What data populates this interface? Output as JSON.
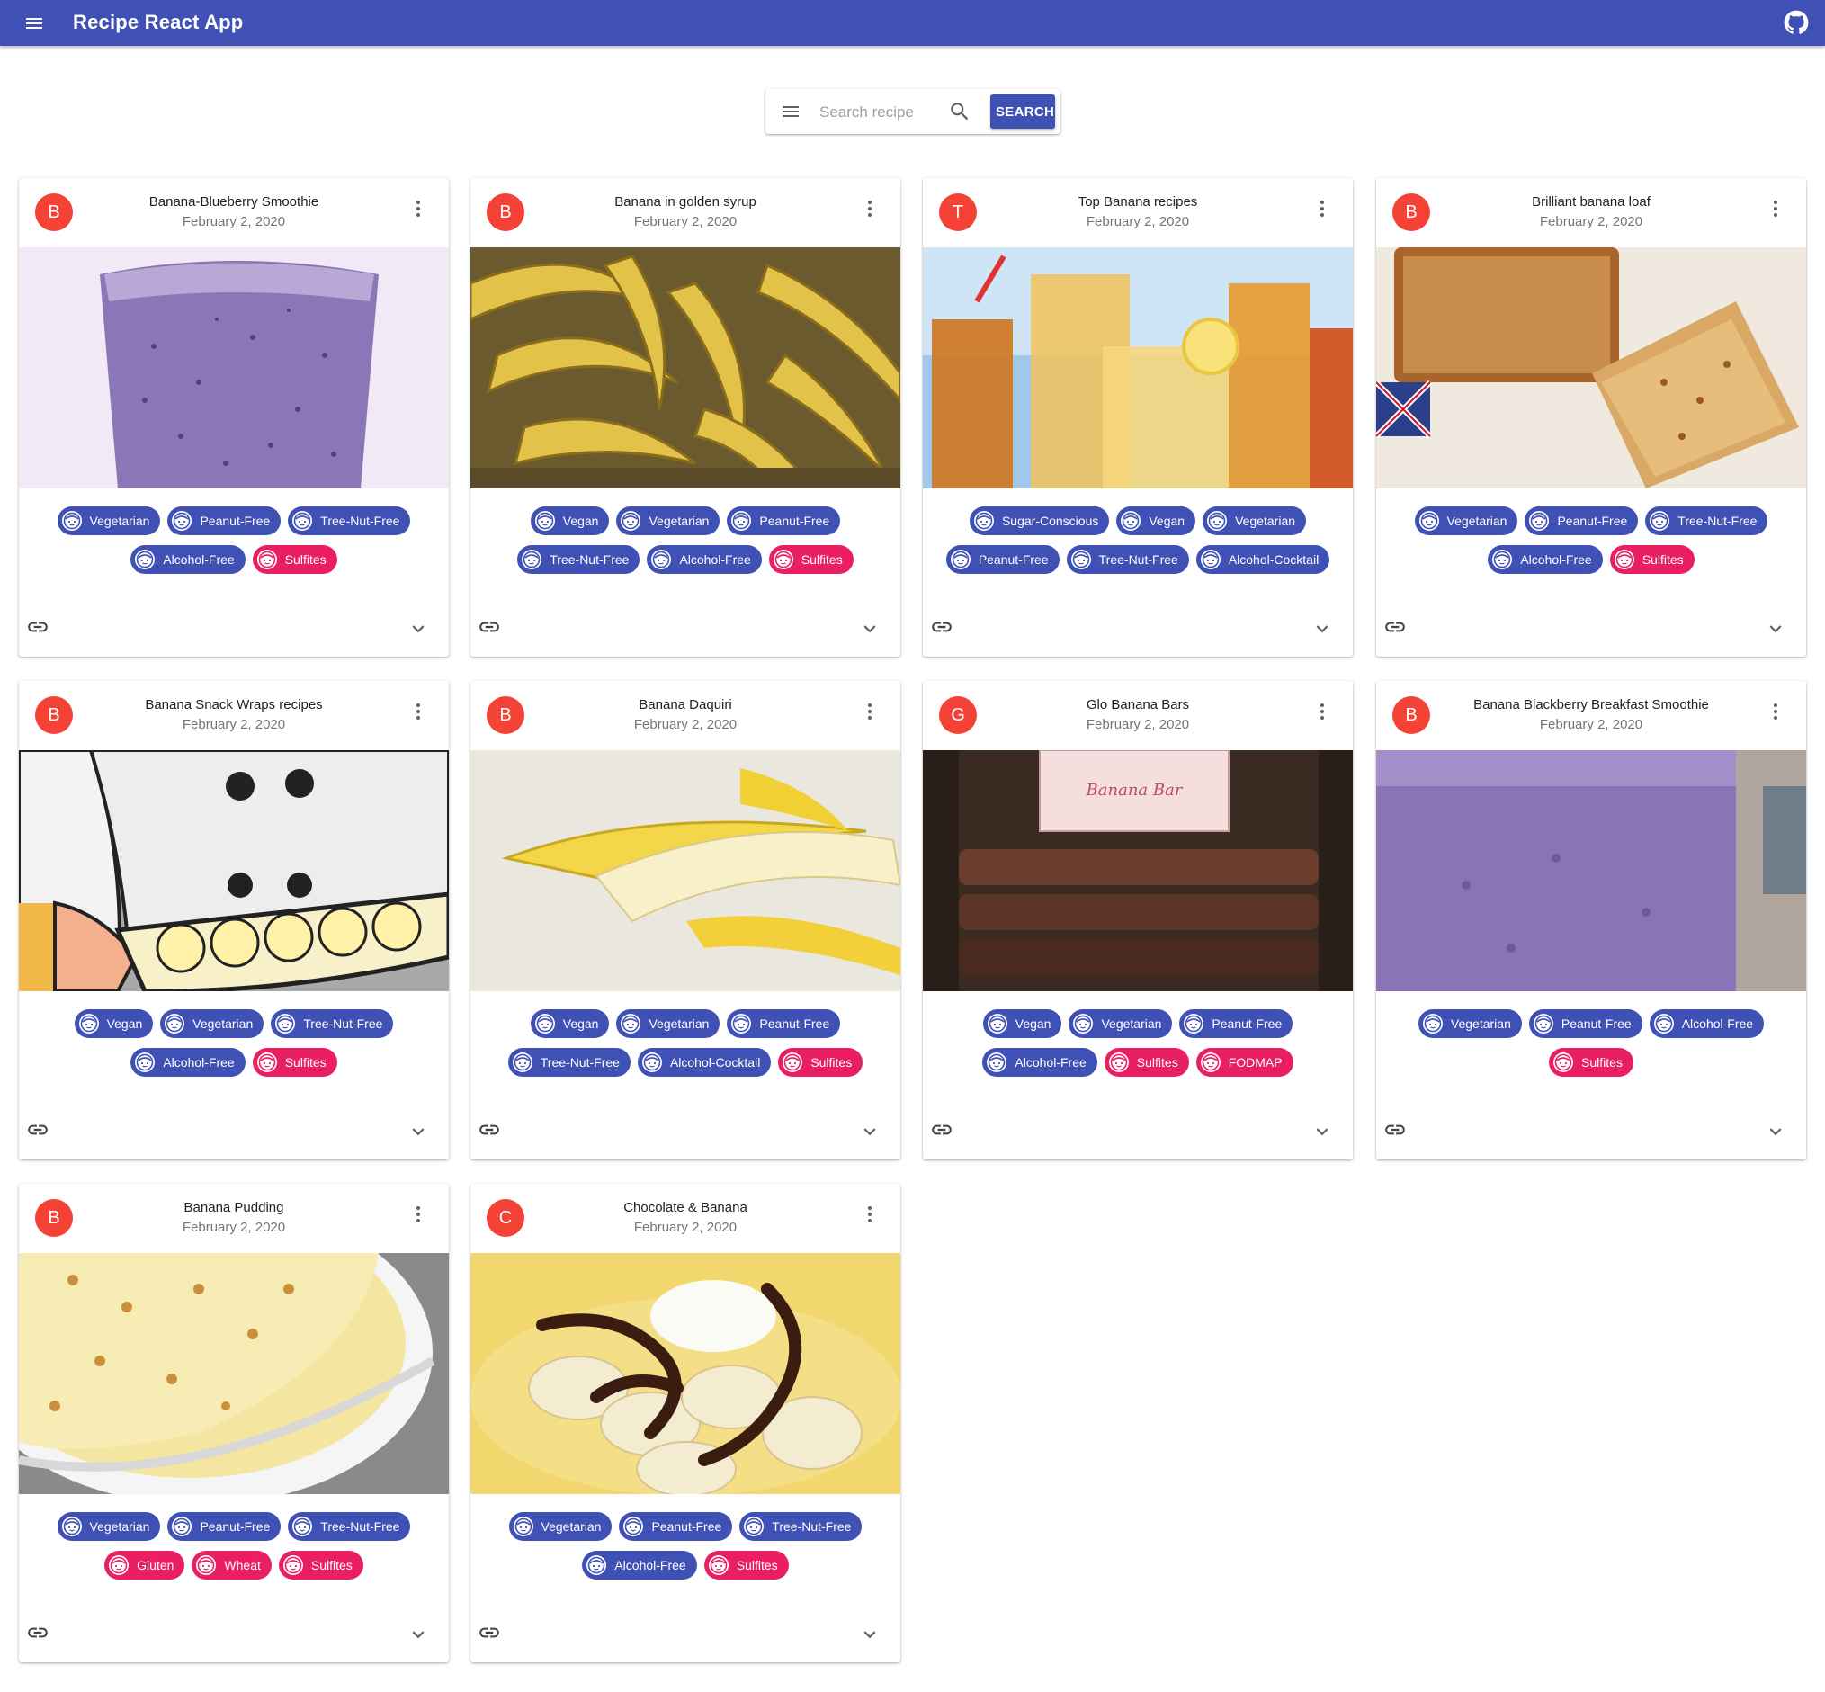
{
  "appbar": {
    "title": "Recip​e React App"
  },
  "search": {
    "placeholder": "Search recipe",
    "value": "",
    "button_label": "SEARCH"
  },
  "colors": {
    "primary": "#3f51b5",
    "secondary": "#e91e63",
    "avatar": "#f44336"
  },
  "cards": [
    {
      "avatar": "B",
      "title": "Banana-Blueberry Smoothie",
      "date": "February 2, 2020",
      "image_desc": "blueberry smoothie",
      "tags": [
        {
          "label": "Vegetarian",
          "type": "health"
        },
        {
          "label": "Peanut-Free",
          "type": "health"
        },
        {
          "label": "Tree-Nut-Free",
          "type": "health"
        },
        {
          "label": "Alcohol-Free",
          "type": "health"
        },
        {
          "label": "Sulfites",
          "type": "caution"
        }
      ]
    },
    {
      "avatar": "B",
      "title": "Banana in golden syrup",
      "date": "February 2, 2020",
      "image_desc": "bananas in basket",
      "tags": [
        {
          "label": "Vegan",
          "type": "health"
        },
        {
          "label": "Vegetarian",
          "type": "health"
        },
        {
          "label": "Peanut-Free",
          "type": "health"
        },
        {
          "label": "Tree-Nut-Free",
          "type": "health"
        },
        {
          "label": "Alcohol-Free",
          "type": "health"
        },
        {
          "label": "Sulfites",
          "type": "caution"
        }
      ]
    },
    {
      "avatar": "T",
      "title": "Top Banana recipes",
      "date": "February 2, 2020",
      "image_desc": "drinks",
      "tags": [
        {
          "label": "Sugar-Conscious",
          "type": "health"
        },
        {
          "label": "Vegan",
          "type": "health"
        },
        {
          "label": "Vegetarian",
          "type": "health"
        },
        {
          "label": "Peanut-Free",
          "type": "health"
        },
        {
          "label": "Tree-Nut-Free",
          "type": "health"
        },
        {
          "label": "Alcohol-Cocktail",
          "type": "health"
        }
      ]
    },
    {
      "avatar": "B",
      "title": "Brilliant banana loaf",
      "date": "February 2, 2020",
      "image_desc": "banana loaf",
      "tags": [
        {
          "label": "Vegetarian",
          "type": "health"
        },
        {
          "label": "Peanut-Free",
          "type": "health"
        },
        {
          "label": "Tree-Nut-Free",
          "type": "health"
        },
        {
          "label": "Alcohol-Free",
          "type": "health"
        },
        {
          "label": "Sulfites",
          "type": "caution"
        }
      ]
    },
    {
      "avatar": "B",
      "title": "Banana Snack Wraps recipes",
      "date": "February 2, 2020",
      "image_desc": "cartoon bowl",
      "tags": [
        {
          "label": "Vegan",
          "type": "health"
        },
        {
          "label": "Vegetarian",
          "type": "health"
        },
        {
          "label": "Tree-Nut-Free",
          "type": "health"
        },
        {
          "label": "Alcohol-Free",
          "type": "health"
        },
        {
          "label": "Sulfites",
          "type": "caution"
        }
      ]
    },
    {
      "avatar": "B",
      "title": "Banana Daquiri",
      "date": "February 2, 2020",
      "image_desc": "peeled banana",
      "tags": [
        {
          "label": "Vegan",
          "type": "health"
        },
        {
          "label": "Vegetarian",
          "type": "health"
        },
        {
          "label": "Peanut-Free",
          "type": "health"
        },
        {
          "label": "Tree-Nut-Free",
          "type": "health"
        },
        {
          "label": "Alcohol-Cocktail",
          "type": "health"
        },
        {
          "label": "Sulfites",
          "type": "caution"
        }
      ]
    },
    {
      "avatar": "G",
      "title": "Glo Banana Bars",
      "date": "February 2, 2020",
      "image_desc": "banana bars",
      "tags": [
        {
          "label": "Vegan",
          "type": "health"
        },
        {
          "label": "Vegetarian",
          "type": "health"
        },
        {
          "label": "Peanut-Free",
          "type": "health"
        },
        {
          "label": "Alcohol-Free",
          "type": "health"
        },
        {
          "label": "Sulfites",
          "type": "caution"
        },
        {
          "label": "FODMAP",
          "type": "caution"
        }
      ]
    },
    {
      "avatar": "B",
      "title": "Banana Blackberry Breakfast Smoothie",
      "date": "February 2, 2020",
      "image_desc": "berry smoothie",
      "tags": [
        {
          "label": "Vegetarian",
          "type": "health"
        },
        {
          "label": "Peanut-Free",
          "type": "health"
        },
        {
          "label": "Alcohol-Free",
          "type": "health"
        },
        {
          "label": "Sulfites",
          "type": "caution"
        }
      ]
    },
    {
      "avatar": "B",
      "title": "Banana Pudding",
      "date": "February 2, 2020",
      "image_desc": "pudding bowl",
      "tags": [
        {
          "label": "Vegetarian",
          "type": "health"
        },
        {
          "label": "Peanut-Free",
          "type": "health"
        },
        {
          "label": "Tree-Nut-Free",
          "type": "health"
        },
        {
          "label": "Gluten",
          "type": "caution"
        },
        {
          "label": "Wheat",
          "type": "caution"
        },
        {
          "label": "Sulfites",
          "type": "caution"
        }
      ]
    },
    {
      "avatar": "C",
      "title": "Chocolate & Banana",
      "date": "February 2, 2020",
      "image_desc": "chocolate banana",
      "tags": [
        {
          "label": "Vegetarian",
          "type": "health"
        },
        {
          "label": "Peanut-Free",
          "type": "health"
        },
        {
          "label": "Tree-Nut-Free",
          "type": "health"
        },
        {
          "label": "Alcohol-Free",
          "type": "health"
        },
        {
          "label": "Sulfites",
          "type": "caution"
        }
      ]
    }
  ]
}
